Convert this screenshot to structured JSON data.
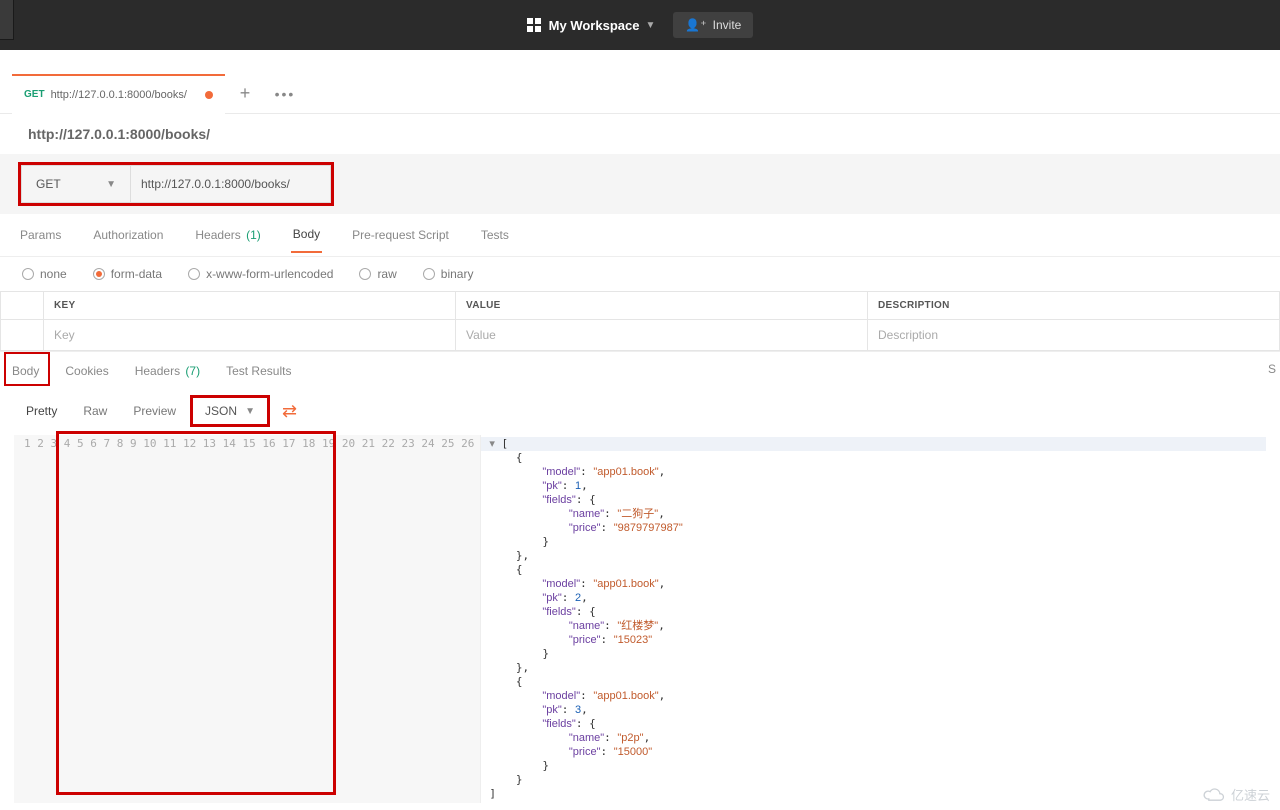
{
  "header": {
    "workspace_label": "My Workspace",
    "invite_label": "Invite"
  },
  "tab": {
    "method": "GET",
    "url": "http://127.0.0.1:8000/books/"
  },
  "request": {
    "title": "http://127.0.0.1:8000/books/",
    "method": "GET",
    "url": "http://127.0.0.1:8000/books/",
    "subtabs": {
      "params": "Params",
      "authorization": "Authorization",
      "headers": "Headers",
      "headers_count": "(1)",
      "body": "Body",
      "prerequest": "Pre-request Script",
      "tests": "Tests"
    },
    "body_types": {
      "none": "none",
      "form_data": "form-data",
      "urlencoded": "x-www-form-urlencoded",
      "raw": "raw",
      "binary": "binary"
    },
    "kv": {
      "key_header": "KEY",
      "value_header": "VALUE",
      "desc_header": "DESCRIPTION",
      "key_placeholder": "Key",
      "value_placeholder": "Value",
      "desc_placeholder": "Description"
    }
  },
  "response": {
    "tabs": {
      "body": "Body",
      "cookies": "Cookies",
      "headers": "Headers",
      "headers_count": "(7)",
      "test_results": "Test Results"
    },
    "right_s": "S",
    "toolbar": {
      "pretty": "Pretty",
      "raw": "Raw",
      "preview": "Preview",
      "format": "JSON"
    },
    "body_data": [
      {
        "model": "app01.book",
        "pk": 1,
        "fields": {
          "name": "二狗子",
          "price": "9879797987"
        }
      },
      {
        "model": "app01.book",
        "pk": 2,
        "fields": {
          "name": "红楼梦",
          "price": "15023"
        }
      },
      {
        "model": "app01.book",
        "pk": 3,
        "fields": {
          "name": "p2p",
          "price": "15000"
        }
      }
    ],
    "line_count": 26
  },
  "watermark": "亿速云"
}
